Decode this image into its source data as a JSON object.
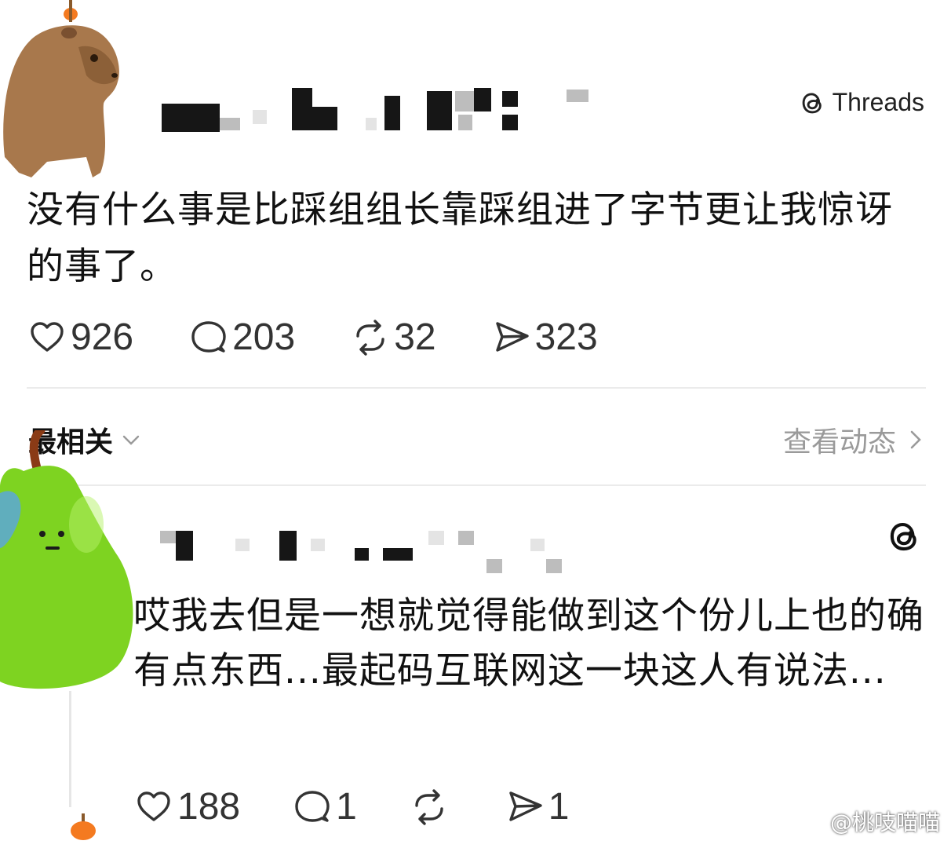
{
  "brand": {
    "name": "Threads"
  },
  "post": {
    "text": "没有什么事是比踩组组长靠踩组进了字节更让我惊讶的事了。",
    "likes": "926",
    "comments": "203",
    "reposts": "32",
    "shares": "323"
  },
  "sort": {
    "label": "最相关",
    "view_activity": "查看动态"
  },
  "reply": {
    "text": "哎我去但是一想就觉得能做到这个份儿上也的确有点东西...最起码互联网这一块这人有说法...",
    "likes": "188",
    "comments": "1",
    "reposts": "",
    "shares": "1"
  },
  "watermark": {
    "text": "@桃吱喵喵"
  },
  "colors": {
    "text": "#111111",
    "muted": "#9a9a9a",
    "divider": "#ebebeb",
    "pear": "#7ed321",
    "capybara": "#a8784c"
  }
}
